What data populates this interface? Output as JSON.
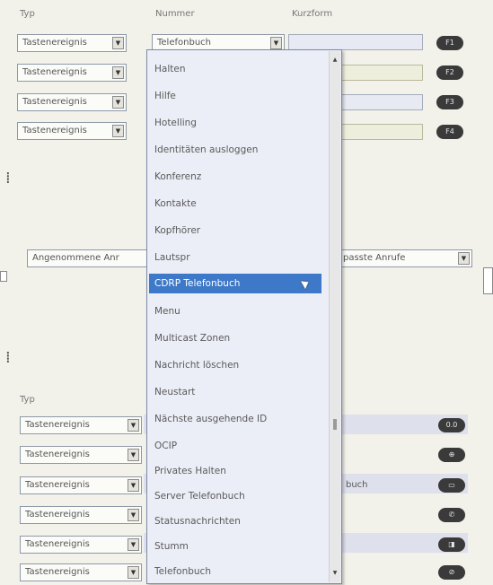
{
  "headers": {
    "typ": "Typ",
    "nummer": "Nummer",
    "kurzform": "Kurzform",
    "typ_lower": "Typ"
  },
  "top_rows": [
    {
      "typ": "Tastenereignis",
      "key": "F1"
    },
    {
      "typ": "Tastenereignis",
      "key": "F2"
    },
    {
      "typ": "Tastenereignis",
      "key": "F3"
    },
    {
      "typ": "Tastenereignis",
      "key": "F4"
    }
  ],
  "nummer_select": {
    "value": "Telefonbuch"
  },
  "middle": {
    "left_select": "Angenommene Anr",
    "right_select": "passte Anrufe"
  },
  "dropdown": {
    "items": [
      "Halten",
      "Hilfe",
      "Hotelling",
      "Identitäten ausloggen",
      "Konferenz",
      "Kontakte",
      "Kopfhörer",
      "Lautspr",
      "CDRP Telefonbuch",
      "Menu",
      "Multicast Zonen",
      "Nachricht löschen",
      "Neustart",
      "Nächste ausgehende ID",
      "OCIP",
      "Privates Halten",
      "Server Telefonbuch",
      "Statusnachrichten",
      "Stumm",
      "Telefonbuch"
    ],
    "selected_index": 8
  },
  "bottom_rows": [
    {
      "typ": "Tastenereignis",
      "key": "0.0",
      "field": ""
    },
    {
      "typ": "Tastenereignis",
      "key": "⊕",
      "field": ""
    },
    {
      "typ": "Tastenereignis",
      "key": "▭",
      "field": "buch"
    },
    {
      "typ": "Tastenereignis",
      "key": "✆",
      "field": ""
    },
    {
      "typ": "Tastenereignis",
      "key": "◨",
      "field": ""
    },
    {
      "typ": "Tastenereignis",
      "key": "⊘",
      "field": ""
    }
  ],
  "colors": {
    "selection": "#3e78c8",
    "pill": "#3a3a3a"
  }
}
